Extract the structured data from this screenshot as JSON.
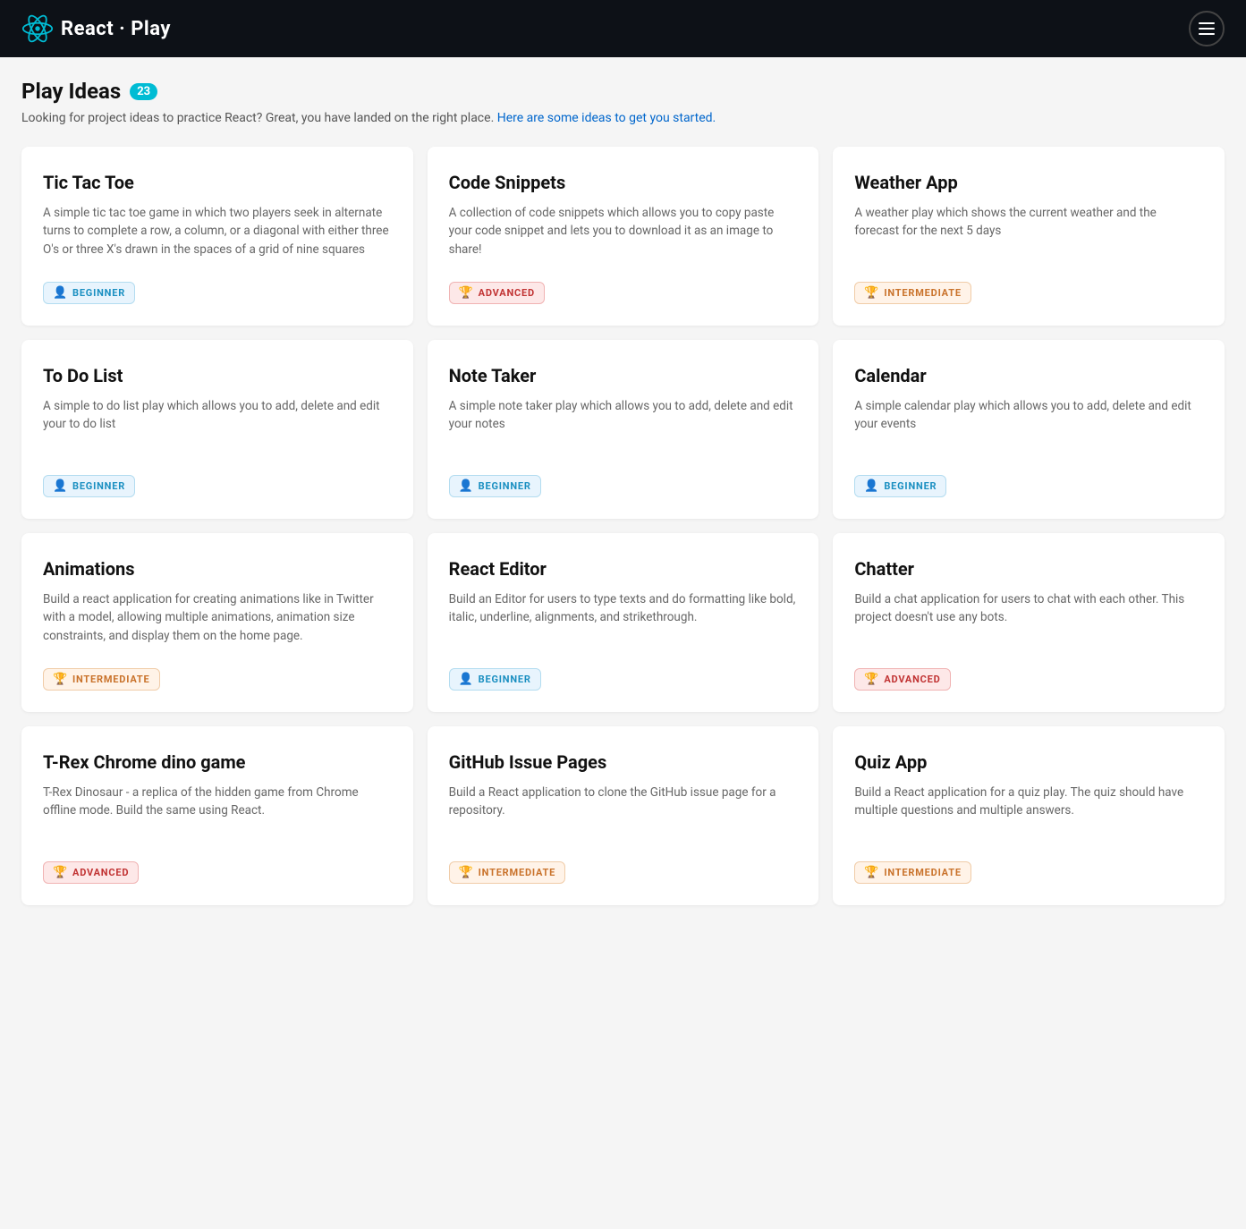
{
  "header": {
    "logo_text_1": "React",
    "logo_text_2": "Play",
    "menu_label": "Menu"
  },
  "page": {
    "title": "Play Ideas",
    "count": "23",
    "description": "Looking for project ideas to practice React? Great, you have landed on the right place.",
    "description_link": "Here are some ideas to get you started.",
    "description_full": "Looking for project ideas to practice React? Great, you have landed on the right place. Here are some ideas to get you started."
  },
  "badges": {
    "beginner": "Beginner",
    "intermediate": "Intermediate",
    "advanced": "Advanced",
    "beginner_icon": "👤",
    "intermediate_icon": "🏆",
    "advanced_icon": "🏆"
  },
  "cards": [
    {
      "id": 1,
      "title": "Tic Tac Toe",
      "description": "A simple tic tac toe game in which two players seek in alternate turns to complete a row, a column, or a diagonal with either three O's or three X's drawn in the spaces of a grid of nine squares",
      "level": "beginner"
    },
    {
      "id": 2,
      "title": "Code Snippets",
      "description": "A collection of code snippets which allows you to copy paste your code snippet and lets you to download it as an image to share!",
      "level": "advanced"
    },
    {
      "id": 3,
      "title": "Weather App",
      "description": "A weather play which shows the current weather and the forecast for the next 5 days",
      "level": "intermediate"
    },
    {
      "id": 4,
      "title": "To Do List",
      "description": "A simple to do list play which allows you to add, delete and edit your to do list",
      "level": "beginner"
    },
    {
      "id": 5,
      "title": "Note Taker",
      "description": "A simple note taker play which allows you to add, delete and edit your notes",
      "level": "beginner"
    },
    {
      "id": 6,
      "title": "Calendar",
      "description": "A simple calendar play which allows you to add, delete and edit your events",
      "level": "beginner"
    },
    {
      "id": 7,
      "title": "Animations",
      "description": "Build a react application for creating animations like in Twitter with a model, allowing multiple animations, animation size constraints, and display them on the home page.",
      "level": "intermediate"
    },
    {
      "id": 8,
      "title": "React Editor",
      "description": "Build an Editor for users to type texts and do formatting like bold, italic, underline, alignments, and strikethrough.",
      "level": "beginner"
    },
    {
      "id": 9,
      "title": "Chatter",
      "description": "Build a chat application for users to chat with each other. This project doesn't use any bots.",
      "level": "advanced"
    },
    {
      "id": 10,
      "title": "T-Rex Chrome dino game",
      "description": "T-Rex Dinosaur - a replica of the hidden game from Chrome offline mode. Build the same using React.",
      "level": "advanced"
    },
    {
      "id": 11,
      "title": "GitHub Issue Pages",
      "description": "Build a React application to clone the GitHub issue page for a repository.",
      "level": "intermediate"
    },
    {
      "id": 12,
      "title": "Quiz App",
      "description": "Build a React application for a quiz play. The quiz should have multiple questions and multiple answers.",
      "level": "intermediate"
    }
  ]
}
